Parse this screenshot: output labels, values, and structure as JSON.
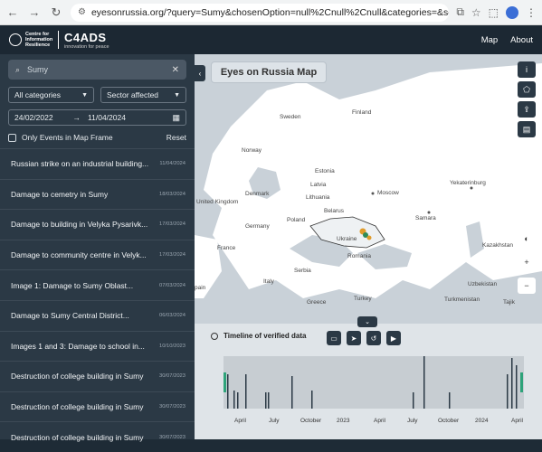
{
  "browser": {
    "url": "eyesonrussia.org/?query=Sumy&chosenOption=null%2Cnull%2Cnull&categories=&sectorAffected..."
  },
  "header": {
    "logo_text": "Centre for Information Resilience",
    "brand": "C4ADS",
    "brand_tagline": "innovation for peace",
    "nav": [
      "Map",
      "About"
    ]
  },
  "sidebar": {
    "search_value": "Sumy",
    "filters": {
      "categories": "All categories",
      "sector": "Sector affected"
    },
    "date_from": "24/02/2022",
    "date_to": "11/04/2024",
    "only_in_frame": "Only Events in Map Frame",
    "reset": "Reset",
    "items": [
      {
        "title": "Russian strike on an industrial building...",
        "date": "11/04/2024"
      },
      {
        "title": "Damage to cemetry in Sumy",
        "date": "18/03/2024"
      },
      {
        "title": "Damage to building in Velyka Pysarivk...",
        "date": "17/03/2024"
      },
      {
        "title": "Damage to community centre in Velyk...",
        "date": "17/03/2024"
      },
      {
        "title": "Image 1: Damage to Sumy Oblast...",
        "date": "07/03/2024"
      },
      {
        "title": "Damage to Sumy Central District...",
        "date": "06/03/2024"
      },
      {
        "title": "Images 1 and 3: Damage to school in...",
        "date": "10/10/2023"
      },
      {
        "title": "Destruction of college building in Sumy",
        "date": "30/07/2023"
      },
      {
        "title": "Destruction of college building in Sumy",
        "date": "30/07/2023"
      },
      {
        "title": "Destruction of college building in Sumy",
        "date": "30/07/2023"
      }
    ]
  },
  "map": {
    "title": "Eyes on Russia Map",
    "labels": [
      "Sweden",
      "Finland",
      "Norway",
      "Estonia",
      "Latvia",
      "Lithuania",
      "Denmark",
      "Moscow",
      "Belarus",
      "Samara",
      "Poland",
      "Germany",
      "United Kingdom",
      "Ukraine",
      "France",
      "Kazakhstan",
      "Serbia",
      "Italy",
      "Turkey",
      "Greece",
      "Uzbekistan",
      "Turkmenistan",
      "Romania",
      "Yekaterinburg",
      "pain",
      "Tajik"
    ]
  },
  "timeline": {
    "title": "Timeline of verified data",
    "axis_labels": [
      "April",
      "July",
      "October",
      "2023",
      "April",
      "July",
      "October",
      "2024",
      "April"
    ]
  }
}
